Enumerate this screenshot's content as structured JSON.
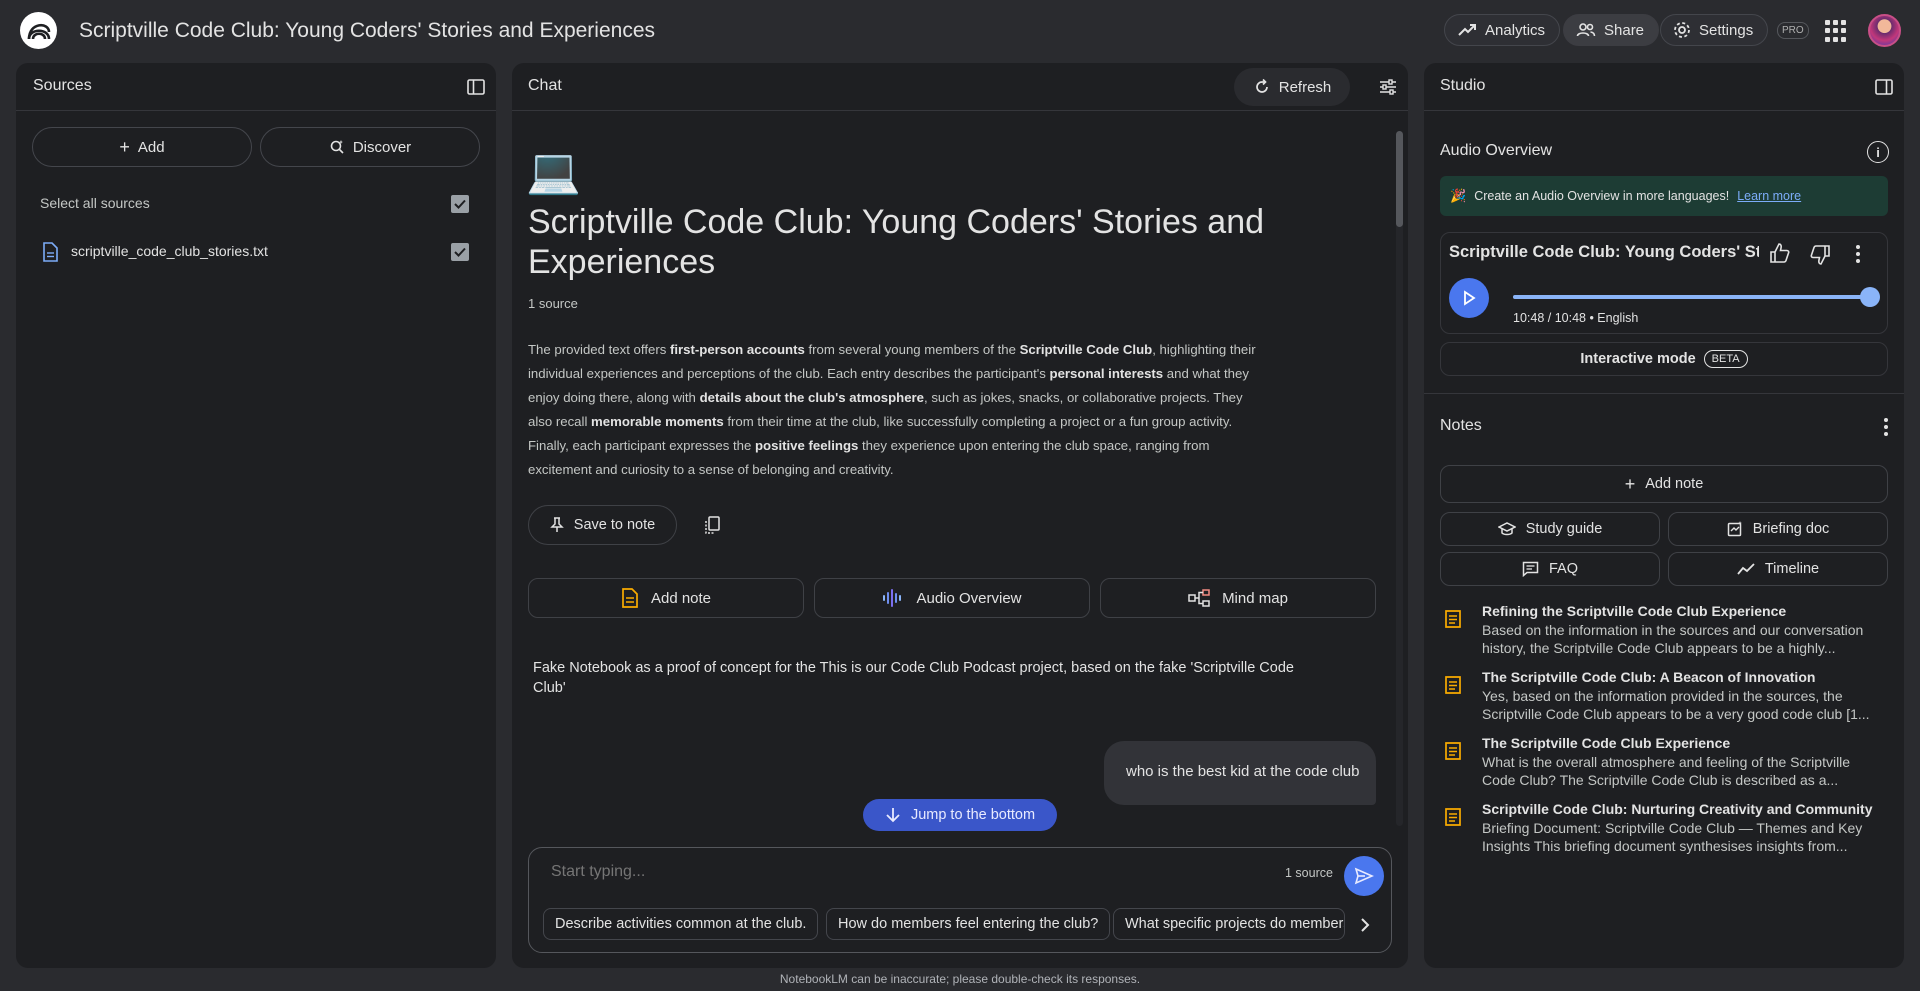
{
  "header": {
    "title": "Scriptville Code Club: Young Coders' Stories and Experiences",
    "analytics_label": "Analytics",
    "share_label": "Share",
    "settings_label": "Settings",
    "pro_badge": "PRO"
  },
  "sources": {
    "title": "Sources",
    "add_label": "Add",
    "discover_label": "Discover",
    "select_all_label": "Select all sources",
    "items": [
      {
        "name": "scriptville_code_club_stories.txt",
        "checked": true
      }
    ]
  },
  "chat": {
    "title": "Chat",
    "refresh_label": "Refresh",
    "emoji": "💻",
    "notebook_title": "Scriptville Code Club: Young Coders' Stories and Experiences",
    "source_count": "1 source",
    "summary": {
      "s1": "The provided text offers ",
      "b1": "first-person accounts",
      "s2": " from several young members of the ",
      "b2": "Scriptville Code Club",
      "s3": ", highlighting their individual experiences and perceptions of the club. Each entry describes the participant's ",
      "b3": "personal interests",
      "s4": " and what they enjoy doing there, along with ",
      "b4": "details about the club's atmosphere",
      "s5": ", such as jokes, snacks, or collaborative projects. They also recall ",
      "b5": "memorable moments",
      "s6": " from their time at the club, like successfully completing a project or a fun group activity. Finally, each participant expresses the ",
      "b6": "positive feelings",
      "s7": " they experience upon entering the club space, ranging from excitement and curiosity to a sense of belonging and creativity."
    },
    "save_to_note_label": "Save to note",
    "actions": {
      "add_note": "Add note",
      "audio_overview": "Audio Overview",
      "mind_map": "Mind map"
    },
    "description": "Fake Notebook as a proof of concept for the This is our Code Club Podcast project, based on the fake 'Scriptville Code Club'",
    "user_message": "who is the best kid at the code club",
    "jump_label": "Jump to the bottom",
    "input_placeholder": "Start typing...",
    "input_source_count": "1 source",
    "suggestions": [
      "Describe activities common at the club.",
      "How do members feel entering the club?",
      "What specific projects do members"
    ]
  },
  "studio": {
    "title": "Studio",
    "audio_overview_title": "Audio Overview",
    "banner_text": "Create an Audio Overview in more languages!",
    "banner_link": "Learn more",
    "audio_title": "Scriptville Code Club: Young Coders' St...",
    "audio_time": "10:48 / 10:48 • English",
    "audio_progress": 1.0,
    "interactive_mode_label": "Interactive mode",
    "beta_label": "BETA",
    "notes_title": "Notes",
    "add_note_label": "Add note",
    "study_guide_label": "Study guide",
    "briefing_doc_label": "Briefing doc",
    "faq_label": "FAQ",
    "timeline_label": "Timeline",
    "notes": [
      {
        "title": "Refining the Scriptville Code Club Experience",
        "snippet": "Based on the information in the sources and our conversation history, the Scriptville Code Club appears to be a highly..."
      },
      {
        "title": "The Scriptville Code Club: A Beacon of Innovation",
        "snippet": "Yes, based on the information provided in the sources, the Scriptville Code Club appears to be a very good code club [1..."
      },
      {
        "title": "The Scriptville Code Club Experience",
        "snippet": "What is the overall atmosphere and feeling of the Scriptville Code Club? The Scriptville Code Club is described as a..."
      },
      {
        "title": "Scriptville Code Club: Nurturing Creativity and Community",
        "snippet": "Briefing Document: Scriptville Code Club — Themes and Key Insights This briefing document synthesises insights from..."
      }
    ]
  },
  "footer": "NotebookLM can be inaccurate; please double-check its responses.",
  "colors": {
    "background": "#2a2b2f",
    "panel": "#1e1f22",
    "accent_blue": "#4a77ee",
    "banner_green": "#1d3c34",
    "note_icon": "#f9ab00"
  }
}
